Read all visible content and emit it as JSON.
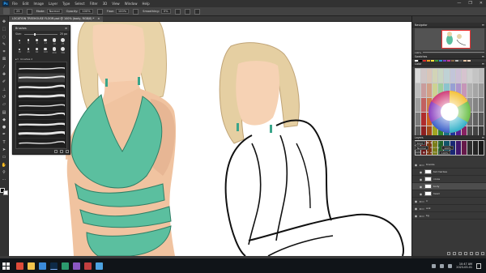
{
  "app": {
    "logo": "Ps",
    "menu": [
      "File",
      "Edit",
      "Image",
      "Layer",
      "Type",
      "Select",
      "Filter",
      "3D",
      "View",
      "Window",
      "Help"
    ],
    "window_controls": [
      "—",
      "❐",
      "✕"
    ]
  },
  "options_bar": {
    "brush_size": "25",
    "mode_label": "Mode:",
    "mode_value": "Normal",
    "opacity_label": "Opacity:",
    "opacity_value": "100%",
    "flow_label": "Flow:",
    "flow_value": "100%",
    "smoothing_label": "Smoothing:",
    "smoothing_value": "0%"
  },
  "document": {
    "tab_title": "LOCATION TREEHOUSE FLOOR.psd @ 100% (body, RGB/8) *",
    "tab_close": "×"
  },
  "brushes_panel": {
    "title": "Brushes",
    "menu_icon": "≡",
    "size_label": "Size:",
    "size_value": "25 px",
    "presets": [
      {
        "num": "1"
      },
      {
        "num": "5"
      },
      {
        "num": "9"
      },
      {
        "num": "13"
      },
      {
        "num": "19"
      },
      {
        "num": "25"
      },
      {
        "num": "30"
      },
      {
        "num": "45"
      },
      {
        "num": "60"
      },
      {
        "num": "100"
      },
      {
        "num": "200"
      },
      {
        "num": "300"
      }
    ],
    "folder_label": "brushes 2",
    "stroke_count": 9,
    "selected_stroke": 1
  },
  "navigator": {
    "title": "Navigator",
    "zoom": "100%"
  },
  "swatches": {
    "title": "Swatches",
    "colors": [
      "#ffffff",
      "#000000",
      "#d82f2f",
      "#f0a020",
      "#f6e23b",
      "#3a9a3a",
      "#2f8fd8",
      "#7a3cc8",
      "#c83c9a",
      "#8a6a4a",
      "#bbbbbb",
      "#555555",
      "#e8c8a8",
      "#f4d7bf"
    ]
  },
  "color_panel": {
    "title": "Color",
    "grid_colors": [
      "#d9d9d9",
      "#d1c6c6",
      "#d9c5b9",
      "#d2d4b6",
      "#c8d6c3",
      "#bfd2d5",
      "#c2c5d9",
      "#cdc0d6",
      "#d6c3cf",
      "#cfcfcf",
      "#c4c4c4",
      "#bcbcbc",
      "#bdbdbd",
      "#c99c9c",
      "#d39f86",
      "#cdd292",
      "#9fcf9d",
      "#8cc4ce",
      "#97a0d3",
      "#ad94cc",
      "#c696b8",
      "#b0b0b0",
      "#a5a5a5",
      "#9a9a9a",
      "#9e9e9e",
      "#c26060",
      "#d07b4b",
      "#c8cf5a",
      "#6abb68",
      "#52aec0",
      "#5a6ccb",
      "#8d5bc3",
      "#b85d98",
      "#8e8e8e",
      "#848484",
      "#7a7a7a",
      "#7b7b7b",
      "#b02c2c",
      "#cf6020",
      "#c5cc2b",
      "#3ca43a",
      "#208fa8",
      "#2d43c0",
      "#6e2bb5",
      "#a82e7b",
      "#6d6d6d",
      "#616161",
      "#575757",
      "#5a5a5a",
      "#8e2020",
      "#a4481a",
      "#a2a622",
      "#2d832c",
      "#187289",
      "#22349b",
      "#561f92",
      "#882262",
      "#4c4c4c",
      "#424242",
      "#383838",
      "#3b3b3b",
      "#6b1616",
      "#7c3612",
      "#7a7d19",
      "#21632a",
      "#115468",
      "#192774",
      "#40166d",
      "#661a4a",
      "#2e2e2e",
      "#242424",
      "#1a1a1a"
    ]
  },
  "layers_panel": {
    "title": "Layers",
    "kind_label": "Kind",
    "blend_mode": "Normal",
    "opacity_label": "Opacity:",
    "opacity_value": "100%",
    "lock_label": "Lock:",
    "fill_label": "Fill:",
    "fill_value": "100%",
    "layers": [
      {
        "name": "trianka",
        "type": "group",
        "visible": true,
        "indent": false,
        "selected": false
      },
      {
        "name": "tail marilea",
        "type": "layer",
        "visible": true,
        "indent": true,
        "selected": false
      },
      {
        "name": "cores",
        "type": "layer",
        "visible": true,
        "indent": true,
        "selected": false
      },
      {
        "name": "body",
        "type": "layer",
        "visible": true,
        "indent": true,
        "selected": true
      },
      {
        "name": "head",
        "type": "layer",
        "visible": true,
        "indent": true,
        "selected": false
      },
      {
        "name": "lr",
        "type": "group",
        "visible": true,
        "indent": false,
        "selected": false
      },
      {
        "name": "ank",
        "type": "group",
        "visible": true,
        "indent": false,
        "selected": false
      },
      {
        "name": "bg",
        "type": "group",
        "visible": true,
        "indent": false,
        "selected": false
      }
    ]
  },
  "taskbar": {
    "time": "10:47 AM",
    "date": "2023-03-01",
    "icons": [
      {
        "name": "chrome-icon",
        "color": "#dd4b39",
        "active": false
      },
      {
        "name": "files-icon",
        "color": "#f3c34c",
        "active": false
      },
      {
        "name": "store-icon",
        "color": "#3b8ad9",
        "active": false
      },
      {
        "name": "photoshop-icon",
        "color": "#0e2a47",
        "active": true
      },
      {
        "name": "app5-icon",
        "color": "#2c9a6e",
        "active": false
      },
      {
        "name": "app6-icon",
        "color": "#8b57c3",
        "active": false
      },
      {
        "name": "app7-icon",
        "color": "#c23f3f",
        "active": false
      },
      {
        "name": "app8-icon",
        "color": "#4da3e0",
        "active": false
      }
    ]
  }
}
